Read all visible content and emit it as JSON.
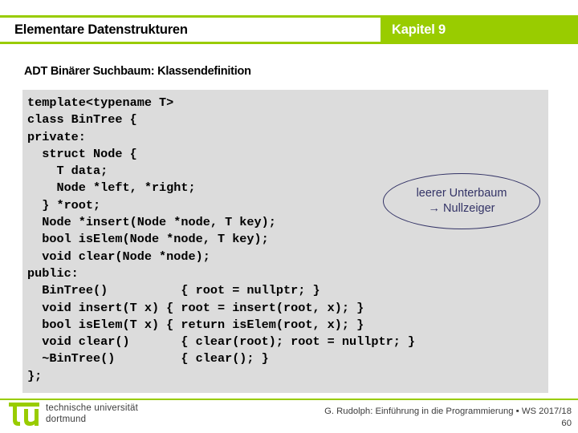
{
  "header": {
    "title": "Elementare Datenstrukturen",
    "chapter": "Kapitel 9",
    "accent_color": "#99cc00"
  },
  "subtitle": "ADT Binärer Suchbaum: Klassendefinition",
  "code": {
    "background_color": "#dcdcdc",
    "lines": [
      "template<typename T>",
      "class BinTree {",
      "private:",
      "  struct Node {",
      "    T data;",
      "    Node *left, *right;",
      "  } *root;",
      "  Node *insert(Node *node, T key);",
      "  bool isElem(Node *node, T key);",
      "  void clear(Node *node);",
      "public:",
      "  BinTree()          { root = nullptr; }",
      "  void insert(T x) { root = insert(root, x); }",
      "  bool isElem(T x) { return isElem(root, x); }",
      "  void clear()       { clear(root); root = nullptr; }",
      "  ~BinTree()         { clear(); }",
      "};"
    ]
  },
  "callout": {
    "line1": "leerer Unterbaum",
    "line2": "→ Nullzeiger",
    "color": "#333366"
  },
  "footer": {
    "logo_text_line1": "technische universität",
    "logo_text_line2": "dortmund",
    "credit": "G. Rudolph: Einführung in die Programmierung ▪ WS 2017/18",
    "page_number": "60"
  }
}
